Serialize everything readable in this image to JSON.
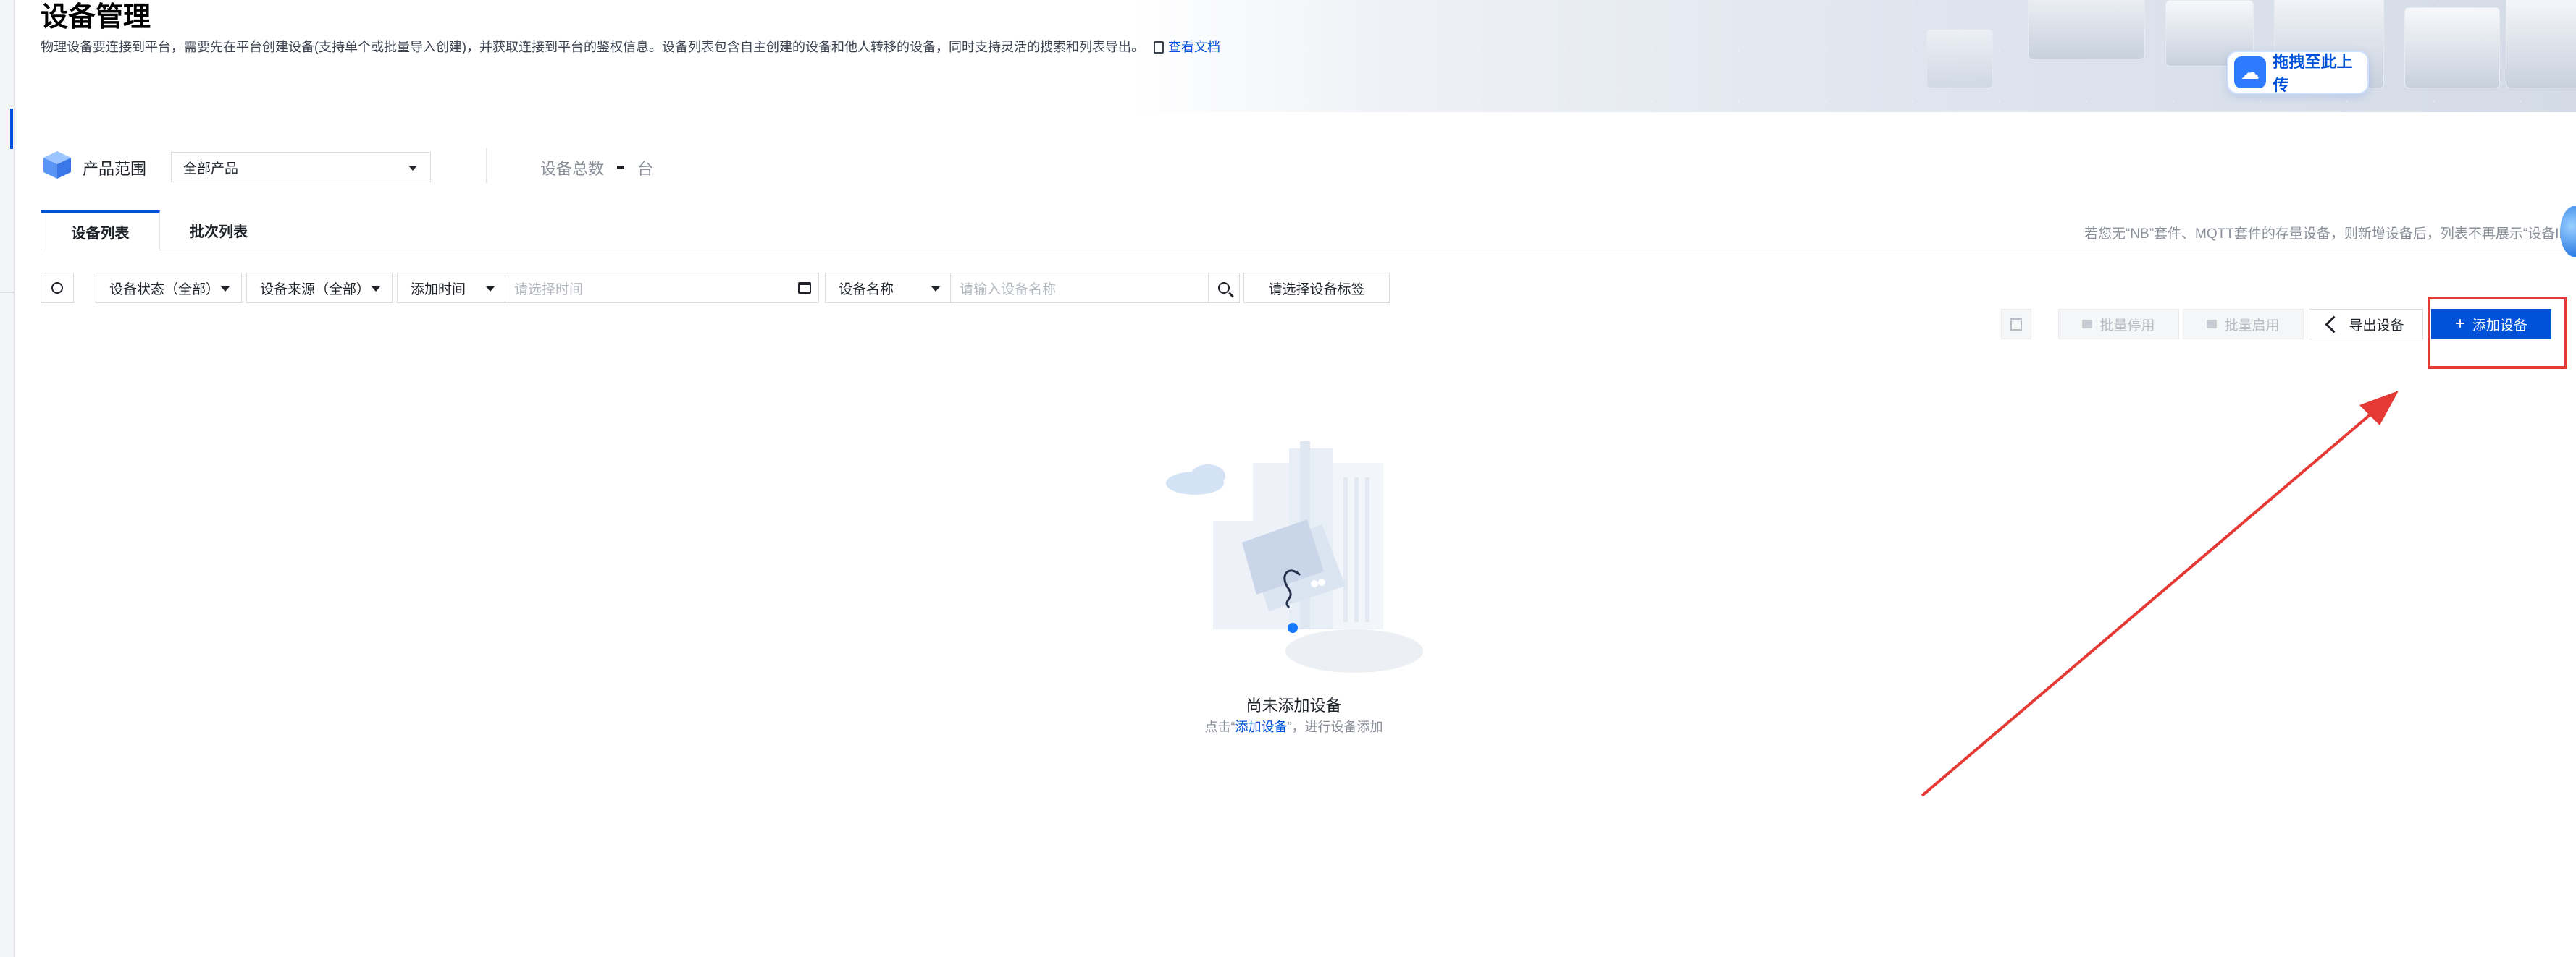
{
  "header": {
    "title": "设备管理",
    "description": "物理设备要连接到平台，需要先在平台创建设备(支持单个或批量导入创建)，并获取连接到平台的鉴权信息。设备列表包含自主创建的设备和他人转移的设备，同时支持灵活的搜索和列表导出。",
    "doc_link": "查看文档"
  },
  "banner": {
    "upload_label": "拖拽至此上传"
  },
  "product": {
    "label": "产品范围",
    "selected": "全部产品"
  },
  "summary": {
    "total_label": "设备总数",
    "total_value": "-",
    "unit": "台"
  },
  "tabs": [
    {
      "label": "设备列表",
      "active": true
    },
    {
      "label": "批次列表",
      "active": false
    }
  ],
  "notice": "若您无“NB”套件、MQTT套件的存量设备，则新增设备后，列表不再展示“设备ID”",
  "filters": {
    "status": "设备状态（全部）",
    "source": "设备来源（全部）",
    "time_field": "添加时间",
    "time_placeholder": "请选择时间",
    "name_field": "设备名称",
    "name_placeholder": "请输入设备名称",
    "tags": "请选择设备标签"
  },
  "actions": {
    "batch_disable": "批量停用",
    "batch_enable": "批量启用",
    "export": "导出设备",
    "add": "添加设备"
  },
  "empty": {
    "title": "尚未添加设备",
    "hint_prefix": "点击“",
    "hint_link": "添加设备",
    "hint_suffix": "”，进行设备添加"
  },
  "colors": {
    "primary": "#0052d9",
    "highlight": "#e53935"
  }
}
